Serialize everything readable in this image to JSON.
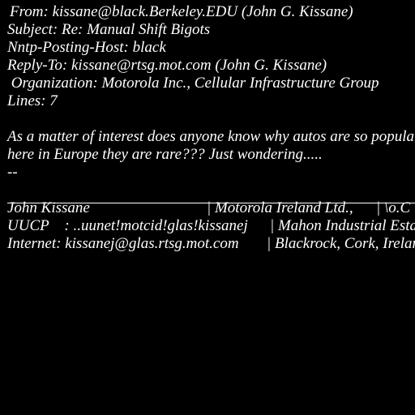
{
  "headers": {
    "from": "From: kissane@black.Berkeley.EDU (John G. Kissane)",
    "subject": "Subject: Re: Manual Shift Bigots",
    "nntp_host": "Nntp-Posting-Host: black",
    "reply_to": "Reply-To: kissane@rtsg.mot.com (John G. Kissane)",
    "organization": " Organization: Motorola Inc., Cellular Infrastructure Group",
    "lines": "Lines: 7"
  },
  "body": {
    "line1": "As a matter of interest does anyone know why autos are so popular",
    "line2": "here in Europe they are rare??? Just wondering.....",
    "sig_dash": "--"
  },
  "signature": {
    "row1": [
      "John Kissane",
      "| Motorola Ireland Ltd.,",
      "| \\o.C"
    ],
    "row2": [
      "UUCP    : ..uunet!motcid!glas!kissanej",
      "| Mahon Industrial Estate"
    ],
    "row3": [
      "Internet: kissanej@glas.rtsg.mot.com",
      "| Blackrock, Cork, Ireland"
    ]
  }
}
